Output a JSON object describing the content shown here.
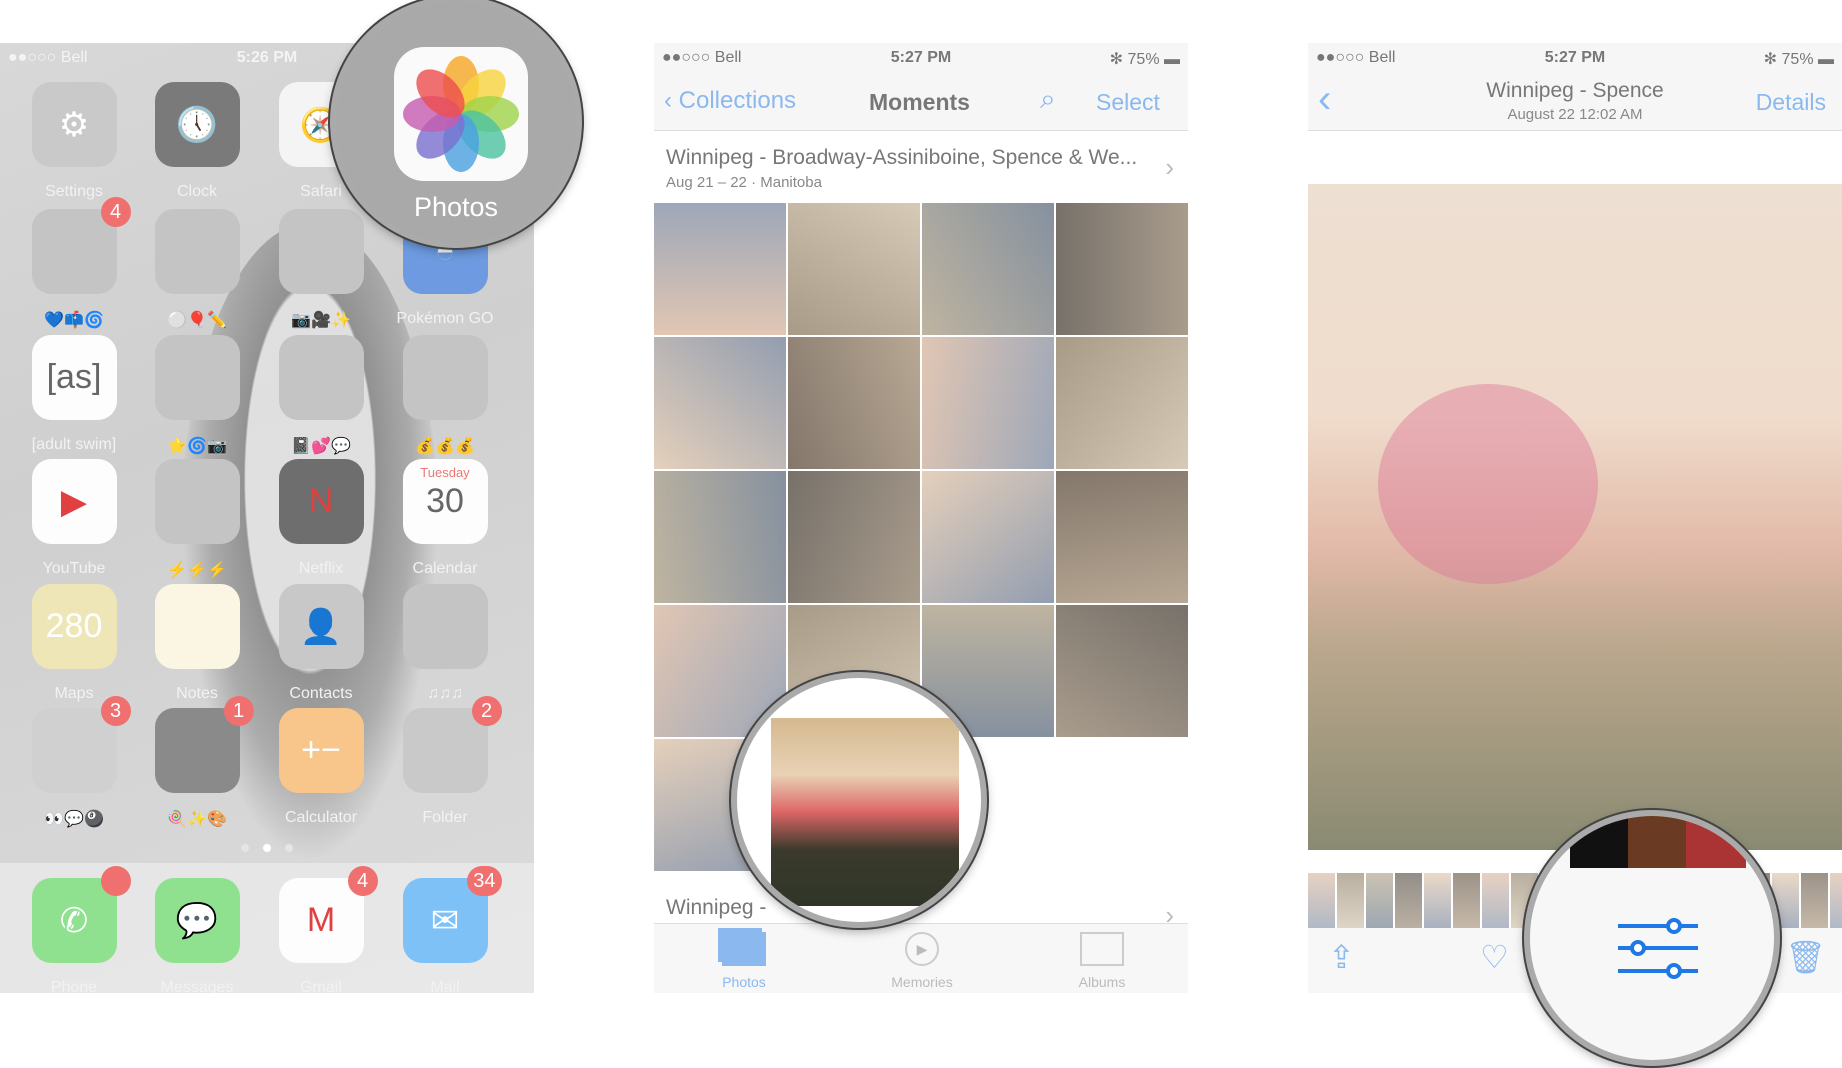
{
  "home": {
    "status": {
      "carrier": "●●○○○ Bell",
      "time": "5:26 PM"
    },
    "rows": [
      [
        {
          "label": "Settings",
          "icon": "gear-icon",
          "bg": "#c9c9c9",
          "glyph": "⚙"
        },
        {
          "label": "Clock",
          "icon": "clock-icon",
          "bg": "#7a7a7a",
          "glyph": "🕔"
        },
        {
          "label": "Safari",
          "icon": "compass-icon",
          "bg": "#f4f4f4",
          "glyph": "🧭"
        },
        null
      ],
      [
        {
          "label": "💙📫🌀",
          "icon": "folder-icon",
          "bg": "#c4c4c4",
          "badge": "4"
        },
        {
          "label": "⚪🎈✏️",
          "icon": "folder-icon",
          "bg": "#c4c4c4"
        },
        {
          "label": "📷🎥✨",
          "icon": "folder-icon",
          "bg": "#c4c4c4"
        },
        {
          "label": "Pokémon GO",
          "icon": "pokeball-icon",
          "bg": "#6d9ae0",
          "glyph": "◓"
        }
      ],
      [
        {
          "label": "[adult swim]",
          "icon": "adult-swim-icon",
          "bg": "#fdfdfd",
          "glyph": "[as]",
          "dark": true
        },
        {
          "label": "⭐🌀📷",
          "icon": "folder-icon",
          "bg": "#c4c4c4"
        },
        {
          "label": "📓💕💬",
          "icon": "folder-icon",
          "bg": "#c4c4c4"
        },
        {
          "label": "💰💰💰",
          "icon": "folder-icon",
          "bg": "#c4c4c4"
        }
      ],
      [
        {
          "label": "YouTube",
          "icon": "play-icon",
          "bg": "#fdfdfd",
          "glyph": "▶",
          "red": true
        },
        {
          "label": "⚡⚡⚡",
          "icon": "folder-icon",
          "bg": "#c4c4c4"
        },
        {
          "label": "Netflix",
          "icon": "netflix-icon",
          "bg": "#6e6e6e",
          "glyph": "N",
          "red": true
        },
        {
          "label": "Calendar",
          "icon": "calendar-icon",
          "bg": "#fdfdfd",
          "glyph": "30",
          "dark": true,
          "sub": "Tuesday"
        }
      ],
      [
        {
          "label": "Maps",
          "icon": "map-icon",
          "bg": "#efe6b8",
          "glyph": "280"
        },
        {
          "label": "Notes",
          "icon": "notes-icon",
          "bg": "#fbf6e4",
          "glyph": ""
        },
        {
          "label": "Contacts",
          "icon": "contacts-icon",
          "bg": "#c8c8c8",
          "glyph": "👤"
        },
        {
          "label": "♫♫♫",
          "icon": "folder-icon",
          "bg": "#c4c4c4"
        }
      ],
      [
        {
          "label": "👀💬🎱",
          "icon": "folder-icon",
          "bg": "#d0d0d0",
          "badge": "3"
        },
        {
          "label": "🍭✨🎨",
          "icon": "folder-icon",
          "bg": "#8a8a8a",
          "badge": "1"
        },
        {
          "label": "Calculator",
          "icon": "calculator-icon",
          "bg": "#f8c58a",
          "glyph": "+−"
        },
        {
          "label": "Folder",
          "icon": "folder-icon",
          "bg": "#c9c9c9",
          "badge": "2"
        }
      ]
    ],
    "dock": [
      {
        "label": "Phone",
        "icon": "phone-icon",
        "bg": "#8fe08f",
        "glyph": "✆",
        "badge": " "
      },
      {
        "label": "Messages",
        "icon": "messages-icon",
        "bg": "#8fe08f",
        "glyph": "💬"
      },
      {
        "label": "Gmail",
        "icon": "gmail-icon",
        "bg": "#fdfdfd",
        "glyph": "M",
        "red": true,
        "badge": "4"
      },
      {
        "label": "Mail",
        "icon": "mail-icon",
        "bg": "#7ec1f7",
        "glyph": "✉",
        "badge": "34"
      }
    ],
    "magnified_app": {
      "label": "Photos",
      "icon": "photos-icon"
    }
  },
  "moments": {
    "status": {
      "carrier": "●●○○○ Bell",
      "time": "5:27 PM",
      "battery": "75%"
    },
    "nav": {
      "back": "Collections",
      "title": "Moments",
      "select": "Select"
    },
    "section1": {
      "title": "Winnipeg - Broadway-Assiniboine, Spence & We...",
      "subtitle": "Aug 21 – 22 · Manitoba"
    },
    "section2": {
      "title": "Winnipeg - "
    },
    "tabs": [
      {
        "label": "Photos",
        "active": true
      },
      {
        "label": "Memories"
      },
      {
        "label": "Albums"
      }
    ]
  },
  "detail": {
    "status": {
      "carrier": "●●○○○ Bell",
      "time": "5:27 PM",
      "battery": "75%"
    },
    "nav": {
      "title": "Winnipeg - Spence",
      "subtitle": "August 22  12:02 AM",
      "details": "Details"
    }
  },
  "colors": {
    "accent": "#8bb8ef",
    "edit_icon": "#1e78e6",
    "badge": "#f07070"
  }
}
